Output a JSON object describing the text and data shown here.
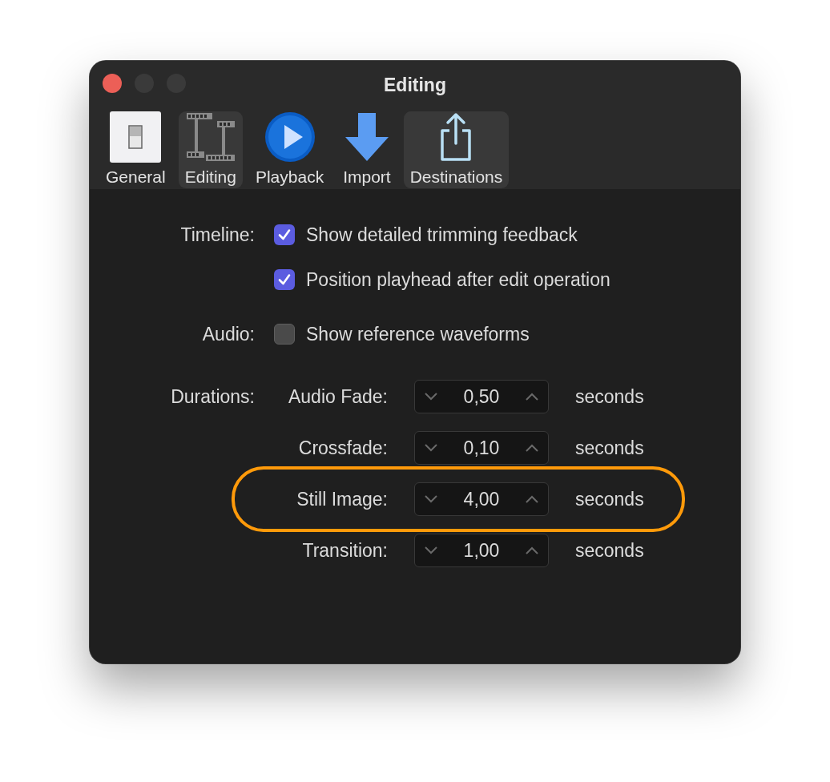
{
  "window": {
    "title": "Editing",
    "controls": [
      {
        "kind": "close",
        "disabled": false
      },
      {
        "kind": "minimize",
        "disabled": true
      },
      {
        "kind": "zoom",
        "disabled": true
      }
    ]
  },
  "toolbar": [
    {
      "kind": "general",
      "label": "General",
      "highlighted": false
    },
    {
      "kind": "editing",
      "label": "Editing",
      "highlighted": true
    },
    {
      "kind": "playback",
      "label": "Playback",
      "highlighted": false
    },
    {
      "kind": "import",
      "label": "Import",
      "highlighted": false
    },
    {
      "kind": "destinations",
      "label": "Destinations",
      "highlighted": true
    }
  ],
  "timeline": {
    "label": "Timeline:",
    "options": [
      {
        "label": "Show detailed trimming feedback",
        "checked": true
      },
      {
        "label": "Position playhead after edit operation",
        "checked": true
      }
    ]
  },
  "audio": {
    "label": "Audio:",
    "options": [
      {
        "label": "Show reference waveforms",
        "checked": false
      }
    ]
  },
  "durations": {
    "label": "Durations:",
    "rows": [
      {
        "label": "Audio Fade:",
        "value": "0,50",
        "unit": "seconds",
        "highlighted": false
      },
      {
        "label": "Crossfade:",
        "value": "0,10",
        "unit": "seconds",
        "highlighted": false
      },
      {
        "label": "Still Image:",
        "value": "4,00",
        "unit": "seconds",
        "highlighted": true
      },
      {
        "label": "Transition:",
        "value": "1,00",
        "unit": "seconds",
        "highlighted": false
      }
    ]
  }
}
